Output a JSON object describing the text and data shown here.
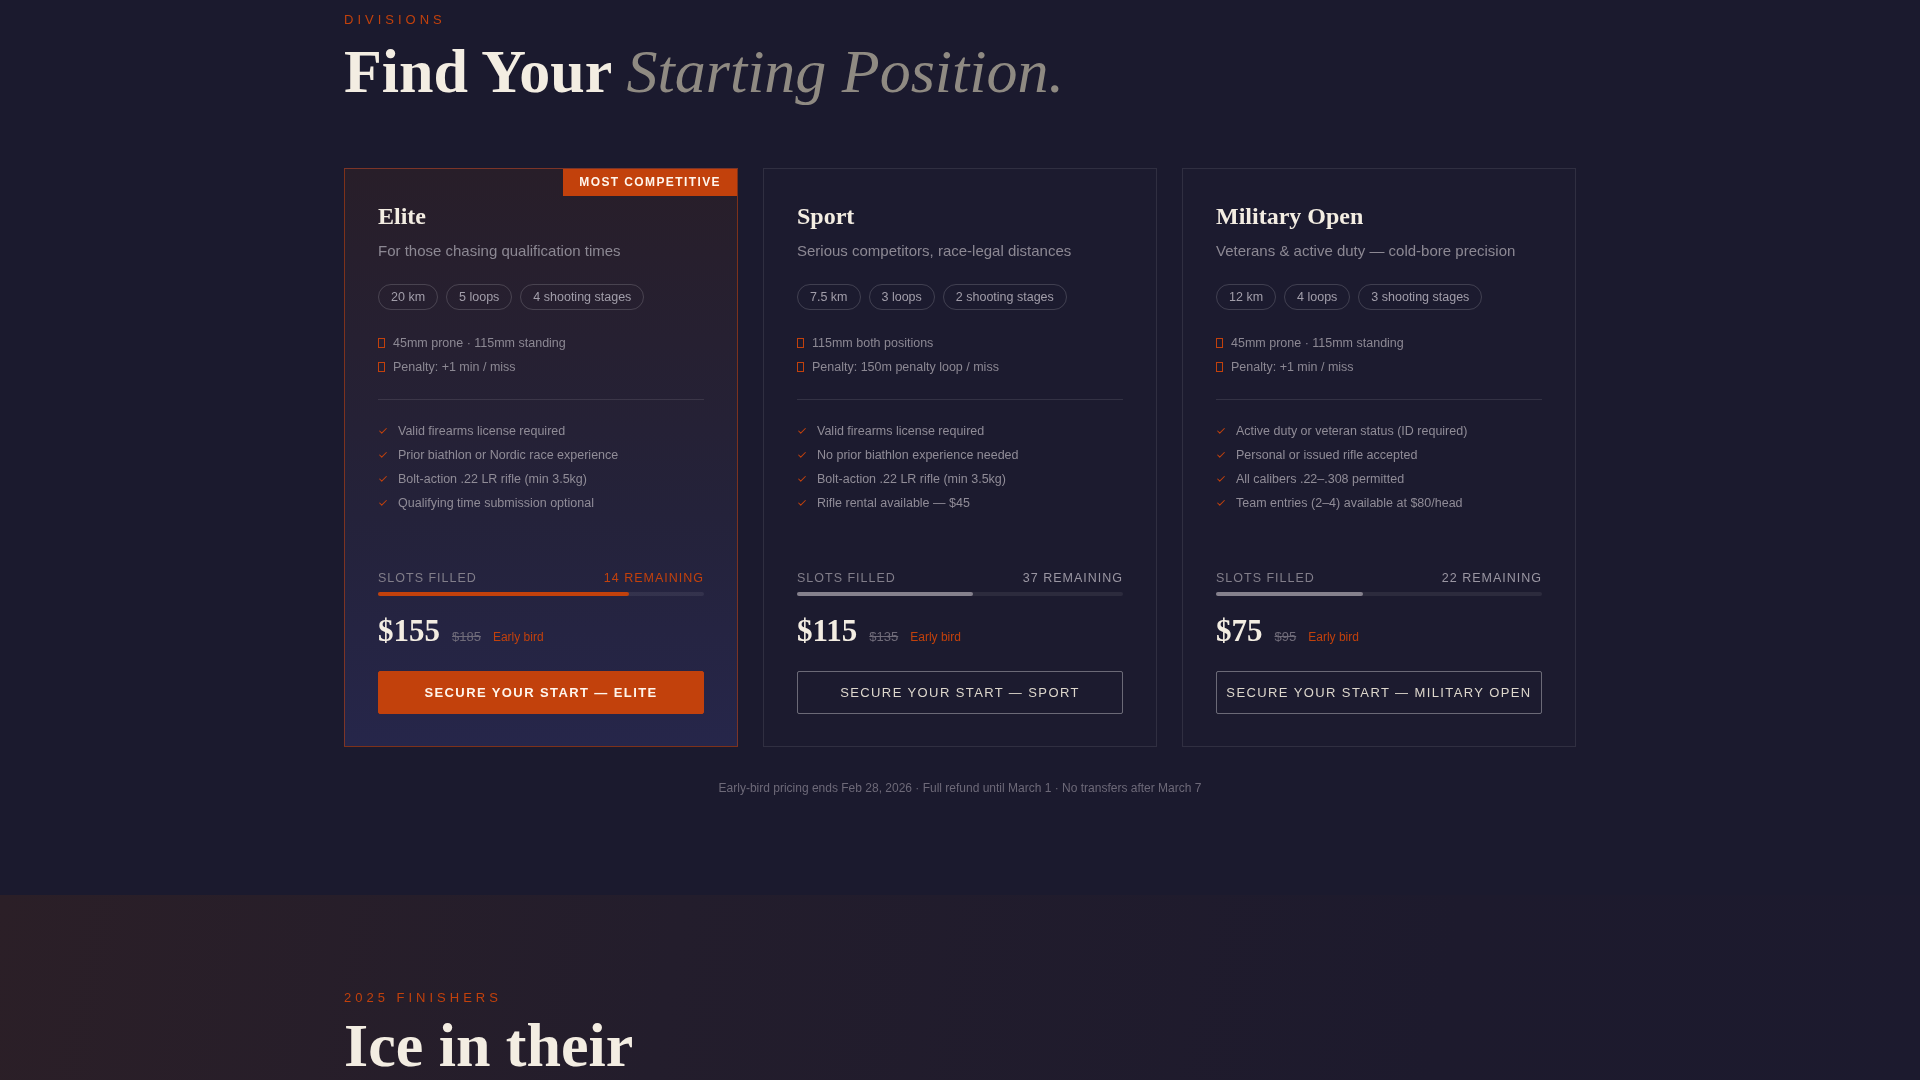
{
  "section": {
    "eyebrow": "DIVISIONS",
    "title": "Find Your *Starting Position.*"
  },
  "divisions": [
    {
      "name": "Elite",
      "featured": true,
      "badge": "MOST COMPETITIVE",
      "tagline": "For those chasing qualification times",
      "tags": [
        "20 km",
        "5 loops",
        "4 shooting stages"
      ],
      "specs": [
        "45mm prone · 115mm standing",
        "Penalty: +1 min / miss"
      ],
      "requirements": [
        "Valid firearms license required",
        "Prior biathlon or Nordic race experience",
        "Bolt-action .22 LR rifle (min 3.5kg)",
        "Qualifying time submission optional"
      ],
      "slots_label": "SLOTS FILLED",
      "remaining": "14 REMAINING",
      "level": 0.77,
      "price": "$155",
      "old_price": "$185",
      "price_note": "Early bird",
      "cta": "SECURE YOUR START — ELITE"
    },
    {
      "name": "Sport",
      "featured": false,
      "tagline": "Serious competitors, race-legal distances",
      "tags": [
        "7.5 km",
        "3 loops",
        "2 shooting stages"
      ],
      "specs": [
        "115mm both positions",
        "Penalty: 150m penalty loop / miss"
      ],
      "requirements": [
        "Valid firearms license required",
        "No prior biathlon experience needed",
        "Bolt-action .22 LR rifle (min 3.5kg)",
        "Rifle rental available — $45"
      ],
      "slots_label": "SLOTS FILLED",
      "remaining": "37 REMAINING",
      "level": 0.54,
      "price": "$115",
      "old_price": "$135",
      "price_note": "Early bird",
      "cta": "SECURE YOUR START — SPORT"
    },
    {
      "name": "Military Open",
      "featured": false,
      "tagline": "Veterans & active duty — cold-bore precision",
      "tags": [
        "12 km",
        "4 loops",
        "3 shooting stages"
      ],
      "specs": [
        "45mm prone · 115mm standing",
        "Penalty: +1 min / miss"
      ],
      "requirements": [
        "Active duty or veteran status (ID required)",
        "Personal or issued rifle accepted",
        "All calibers .22–.308 permitted",
        "Team entries (2–4) available at $80/head"
      ],
      "slots_label": "SLOTS FILLED",
      "remaining": "22 REMAINING",
      "level": 0.45,
      "price": "$75",
      "old_price": "$95",
      "price_note": "Early bird",
      "cta": "SECURE YOUR START — MILITARY OPEN"
    }
  ],
  "footnote": "Early-bird pricing ends Feb 28, 2026 · Full refund until March 1 · No transfers after March 7",
  "next_section": {
    "eyebrow": "2025 FINISHERS",
    "title": "Ice in their"
  }
}
